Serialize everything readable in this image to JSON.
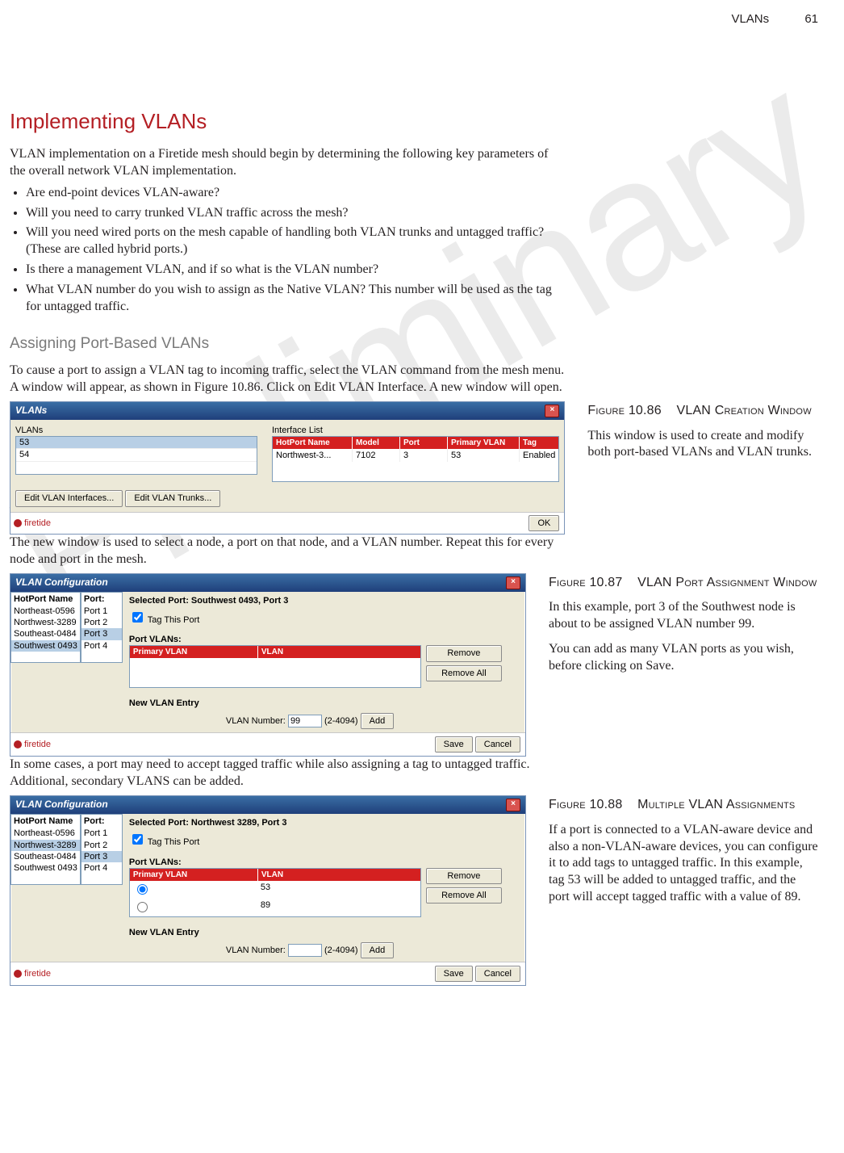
{
  "runhead": {
    "title": "VLANs",
    "page": "61"
  },
  "watermark": "Preliminary",
  "h1": "Implementing VLANs",
  "intro": "VLAN implementation on a Firetide mesh should begin by determining the following key parameters of the overall network VLAN implementation.",
  "bullets": [
    "Are end-point devices VLAN-aware?",
    "Will you need to carry trunked VLAN traffic across the mesh?",
    "Will you need wired ports on the mesh capable of handling both VLAN trunks and untagged traffic? (These are called hybrid ports.)",
    "Is there a management VLAN, and if so what is the VLAN number?",
    "What VLAN number do you wish to assign as the Native VLAN? This number will be used as the tag for untagged traffic."
  ],
  "h2": "Assigning Port-Based VLANs",
  "para2": "To cause a port to assign a VLAN tag to incoming traffic, select the VLAN command from the mesh menu. A window will appear, as shown in Figure 10.86. Click on Edit VLAN Interface. A new window will open.",
  "para3": "The new window is used to select a node, a port on that node, and a VLAN number. Repeat this for every node and port in the mesh.",
  "para4": "In some cases, a port may need to accept tagged traffic while also assigning a tag to untagged traffic. Additional, secondary VLANS can be added.",
  "fig86": {
    "title_a": "Figure 10.86",
    "title_b": "VLAN Creation Window",
    "caption": "This window is used to create and modify both port-based VLANs and VLAN trunks.",
    "win_title": "VLANs",
    "left_label": "VLANs",
    "vlan_list": [
      "53",
      "54"
    ],
    "iface_label": "Interface List",
    "iface_headers": [
      "HotPort Name",
      "Model",
      "Port",
      "Primary VLAN",
      "Tag"
    ],
    "iface_row": [
      "Northwest-3...",
      "7102",
      "3",
      "53",
      "Enabled"
    ],
    "btn1": "Edit VLAN Interfaces...",
    "btn2": "Edit VLAN Trunks...",
    "ok": "OK",
    "brand": "firetide"
  },
  "fig87": {
    "title_a": "Figure 10.87",
    "title_b": "VLAN Port Assignment Window",
    "caption1": "In this example, port 3 of the Southwest node is about to be assigned VLAN number 99.",
    "caption2": "You can add as many VLAN ports as you wish, before clicking on Save.",
    "win_title": "VLAN Configuration",
    "hp_label": "HotPort Name",
    "port_label": "Port:",
    "hotports": [
      "Northeast-0596",
      "Northwest-3289",
      "Southeast-0484",
      "Southwest 0493"
    ],
    "hp_selected_index": 3,
    "ports": [
      "Port 1",
      "Port 2",
      "Port 3",
      "Port 4"
    ],
    "port_selected_index": 2,
    "sel_port": "Selected Port:  Southwest 0493, Port 3",
    "tag_chk": "Tag This Port",
    "pv_label": "Port VLANs:",
    "pv_headers": [
      "Primary VLAN",
      "VLAN"
    ],
    "pv_rows": [],
    "remove": "Remove",
    "remove_all": "Remove All",
    "new_entry": "New VLAN Entry",
    "vlan_no_label": "VLAN Number:",
    "vlan_no_value": "99",
    "range": "(2-4094)",
    "add": "Add",
    "save": "Save",
    "cancel": "Cancel",
    "brand": "firetide"
  },
  "fig88": {
    "title_a": "Figure 10.88",
    "title_b": "Multiple VLAN Assignments",
    "caption": "If a port is connected to a VLAN-aware device and also a non-VLAN-aware devices, you can configure it to add tags to untagged traffic. In this example, tag 53 will be added to untagged traffic, and the port will accept tagged traffic with a value of 89.",
    "win_title": "VLAN Configuration",
    "hp_label": "HotPort Name",
    "port_label": "Port:",
    "hotports": [
      "Northeast-0596",
      "Northwest-3289",
      "Southeast-0484",
      "Southwest 0493"
    ],
    "hp_selected_index": 1,
    "ports": [
      "Port 1",
      "Port 2",
      "Port 3",
      "Port 4"
    ],
    "port_selected_index": 2,
    "sel_port": "Selected Port:  Northwest 3289, Port 3",
    "tag_chk": "Tag This Port",
    "pv_label": "Port VLANs:",
    "pv_headers": [
      "Primary VLAN",
      "VLAN"
    ],
    "pv_rows": [
      {
        "primary": true,
        "vlan": "53"
      },
      {
        "primary": false,
        "vlan": "89"
      }
    ],
    "remove": "Remove",
    "remove_all": "Remove All",
    "new_entry": "New VLAN Entry",
    "vlan_no_label": "VLAN Number:",
    "vlan_no_value": "",
    "range": "(2-4094)",
    "add": "Add",
    "save": "Save",
    "cancel": "Cancel",
    "brand": "firetide"
  }
}
